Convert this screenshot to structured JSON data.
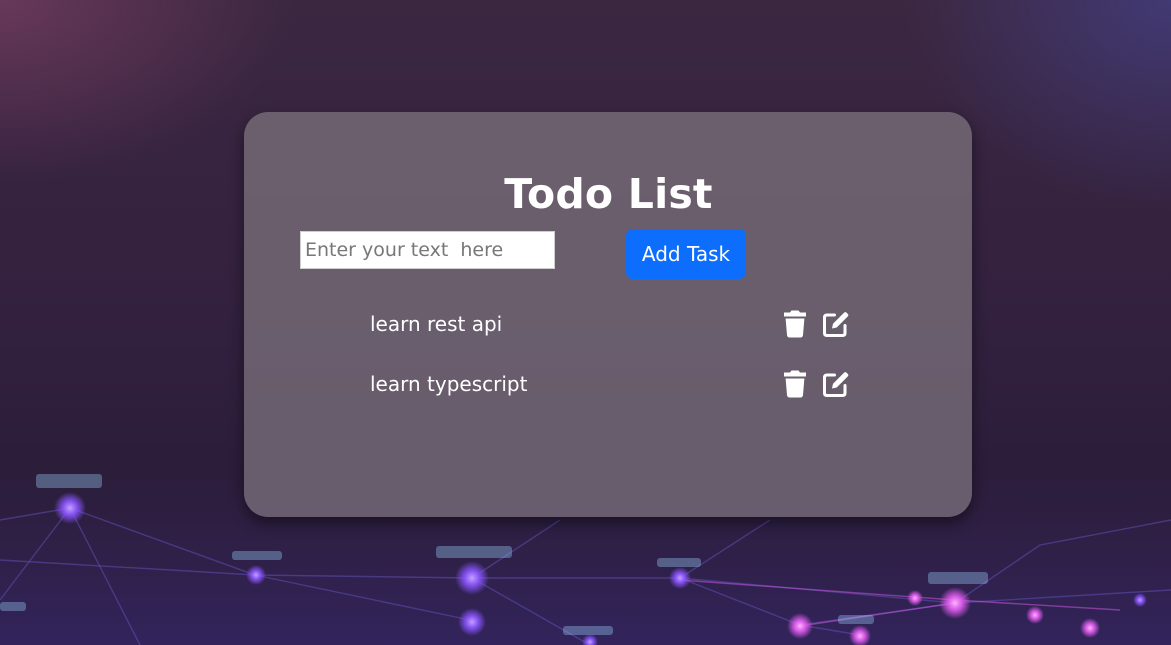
{
  "app": {
    "title": "Todo List"
  },
  "form": {
    "input_value": "",
    "input_placeholder": "Enter your text  here",
    "add_label": "Add Task"
  },
  "tasks": [
    {
      "label": "learn rest api"
    },
    {
      "label": "learn typescript"
    }
  ],
  "icons": {
    "delete": "trash-icon",
    "edit": "edit-icon"
  },
  "colors": {
    "accent": "#0d6efd",
    "text": "#ffffff"
  }
}
